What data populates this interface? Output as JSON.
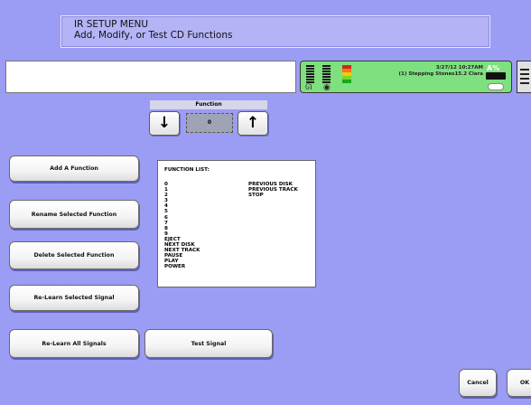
{
  "header": {
    "title": "IR SETUP MENU",
    "subtitle": "Add, Modify, or Test CD Functions"
  },
  "status": {
    "datetime": "3/27/12 10:27AM",
    "now_playing": "(1) Stepping Stones15.2 Clara",
    "mode": "A%",
    "meter_colors": [
      "#d92020",
      "#ee7a10",
      "#f0c818",
      "#7cd62a",
      "#18a818"
    ]
  },
  "function_selector": {
    "label": "Function",
    "value": "0",
    "down_icon": "arrow-down-icon",
    "up_icon": "arrow-up-icon"
  },
  "buttons": {
    "add": "Add A Function",
    "rename": "Rename Selected Function",
    "delete": "Delete Selected Function",
    "relearn_selected": "Re-Learn Selected Signal",
    "relearn_all": "Re-Learn All Signals",
    "test": "Test Signal",
    "cancel": "Cancel",
    "ok": "OK"
  },
  "function_list": {
    "title": "FUNCTION LIST:",
    "column1": [
      "0",
      "1",
      "2",
      "3",
      "4",
      "5",
      "6",
      "7",
      "8",
      "9",
      "EJECT",
      "NEXT DISK",
      "NEXT TRACK",
      "PAUSE",
      "PLAY",
      "POWER"
    ],
    "column2": [
      "PREVIOUS DISK",
      "PREVIOUS TRACK",
      "STOP"
    ]
  }
}
